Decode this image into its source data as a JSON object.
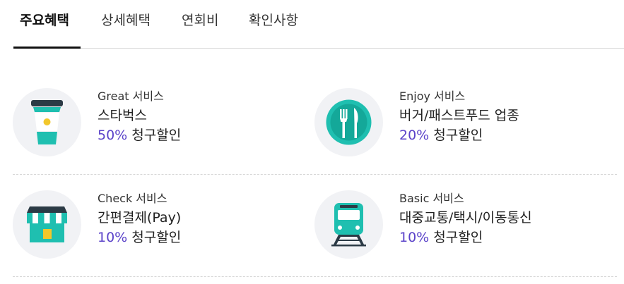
{
  "tabs": [
    {
      "label": "주요혜택",
      "active": true
    },
    {
      "label": "상세혜택",
      "active": false
    },
    {
      "label": "연회비",
      "active": false
    },
    {
      "label": "확인사항",
      "active": false
    }
  ],
  "benefits": [
    {
      "service": "Great 서비스",
      "title": "스타벅스",
      "percent": "50%",
      "discount_label": "청구할인",
      "icon": "coffee-cup-icon"
    },
    {
      "service": "Enjoy 서비스",
      "title": "버거/패스트푸드 업종",
      "percent": "20%",
      "discount_label": "청구할인",
      "icon": "fork-knife-plate-icon"
    },
    {
      "service": "Check 서비스",
      "title": "간편결제(Pay)",
      "percent": "10%",
      "discount_label": "청구할인",
      "icon": "storefront-icon"
    },
    {
      "service": "Basic 서비스",
      "title": "대중교통/택시/이동통신",
      "percent": "10%",
      "discount_label": "청구할인",
      "icon": "train-icon"
    }
  ],
  "colors": {
    "accent_percent": "#5b43c9",
    "icon_teal": "#1fbfb0",
    "icon_dark": "#2b3a45",
    "icon_bg": "#f1f2f5"
  }
}
